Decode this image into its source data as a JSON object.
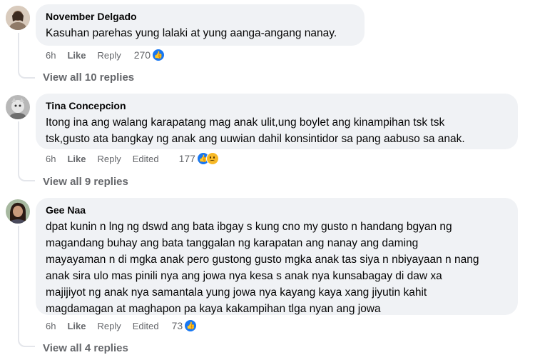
{
  "comments": [
    {
      "author": "November Delgado",
      "text": "Kasuhan parehas yung lalaki at yung aanga-angang nanay.",
      "time": "6h",
      "like_label": "Like",
      "reply_label": "Reply",
      "edited_label": "",
      "reaction_count": "270",
      "reactions": [
        "like-icon"
      ],
      "view_replies": "View all 10 replies"
    },
    {
      "author": "Tina Concepcion",
      "text_lines": [
        "Itong ina ang walang karapatang mag anak ulit,ung boylet ang kinampihan tsk tsk",
        "tsk,gusto ata bangkay ng anak ang uuwian dahil konsintidor sa pang aabuso sa anak."
      ],
      "time": "6h",
      "like_label": "Like",
      "reply_label": "Reply",
      "edited_label": "Edited",
      "reaction_count": "177",
      "reactions": [
        "like-icon",
        "sad-icon"
      ],
      "view_replies": "View all 9 replies"
    },
    {
      "author": "Gee Naa",
      "text_lines": [
        "dpat kunin n lng ng dswd ang bata ibgay s kung cno my gusto n handang bgyan ng",
        "magandang buhay ang bata tanggalan ng karapatan ang nanay ang daming",
        "mayayaman n di mgka anak pero gustong gusto mgka anak tas siya n nbiyayaan n nang",
        "anak sira ulo mas pinili nya ang jowa nya kesa s anak nya kunsabagay di daw xa",
        "majijiyot ng anak nya samantala yung jowa nya kayang kaya xang jiyutin kahit",
        "magdamagan at maghapon pa kaya kakampihan tlga nyan ang jowa"
      ],
      "time": "6h",
      "like_label": "Like",
      "reply_label": "Reply",
      "edited_label": "Edited",
      "reaction_count": "73",
      "reactions": [
        "like-icon"
      ],
      "view_replies": "View all 4 replies"
    }
  ],
  "colors": {
    "bubble": "#f0f2f5",
    "meta": "#65676b",
    "like": "#1877f2",
    "sad": "#f7b928"
  }
}
